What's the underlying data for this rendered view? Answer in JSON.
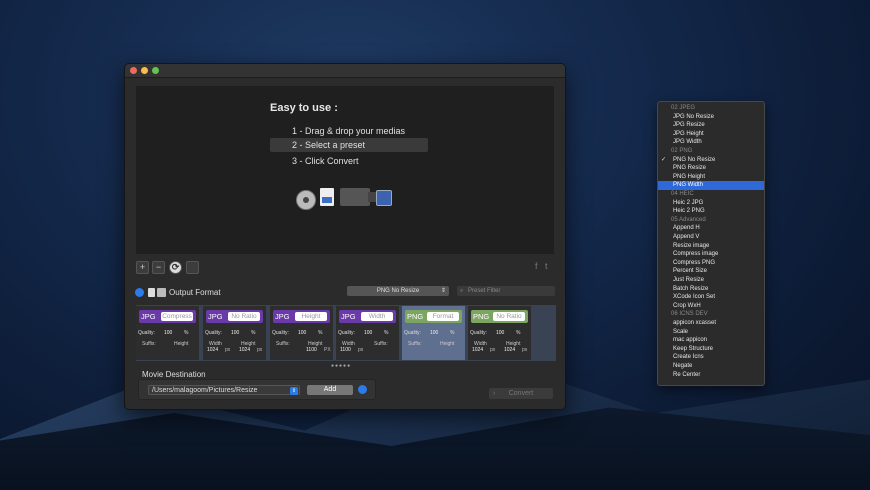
{
  "window": {
    "dropzone": {
      "title": "Easy to use :",
      "step1": "1 - Drag & drop your medias",
      "step2": "2 - Select a preset",
      "step3": "3 - Click Convert"
    },
    "toolbar": {
      "plus": "+",
      "minus": "−",
      "cycle": "⟳",
      "trash": "🗑"
    },
    "social": {
      "facebook": "f",
      "twitter": "t"
    },
    "output_format_label": "Output Format",
    "preset_select_value": "PNG No Resize",
    "preset_filter_placeholder": "Preset Filter",
    "cards": [
      {
        "format": "JPG",
        "preset": "Compress",
        "quality_label": "Quality:",
        "quality": "100",
        "pct": "%",
        "l1": "Suffix:",
        "l2": "Height",
        "v1": "",
        "v2": "",
        "u1": "",
        "u2": ""
      },
      {
        "format": "JPG",
        "preset": "No Ratio",
        "quality_label": "Quality:",
        "quality": "100",
        "pct": "%",
        "l1": "Width",
        "l2": "Height",
        "v1": "1024",
        "v2": "1024",
        "u1": "px",
        "u2": "px"
      },
      {
        "format": "JPG",
        "preset": "Height",
        "quality_label": "Quality:",
        "quality": "100",
        "pct": "%",
        "l1": "Suffix:",
        "l2": "Height",
        "v1": "",
        "v2": "1100",
        "u1": "",
        "u2": "PX"
      },
      {
        "format": "JPG",
        "preset": "Width",
        "quality_label": "Quality:",
        "quality": "100",
        "pct": "%",
        "l1": "Width",
        "l2": "Suffix:",
        "v1": "1100",
        "v2": "",
        "u1": "px",
        "u2": ""
      },
      {
        "format": "PNG",
        "preset": "Format",
        "quality_label": "Quality:",
        "quality": "100",
        "pct": "%",
        "l1": "Suffix:",
        "l2": "Height",
        "v1": "",
        "v2": "",
        "u1": "",
        "u2": ""
      },
      {
        "format": "PNG",
        "preset": "No Ratio",
        "quality_label": "Quality:",
        "quality": "100",
        "pct": "%",
        "l1": "Width",
        "l2": "Height",
        "v1": "1024",
        "v2": "1024",
        "u1": "px",
        "u2": "px"
      }
    ],
    "pager": "●●●●●",
    "movie_destination_label": "Movie Destination",
    "destination_path": "/Users/malagoom/Pictures/Resize",
    "add_label": "Add",
    "convert_label": "Convert"
  },
  "dropdown": {
    "items": [
      {
        "type": "header",
        "label": "02 JPEG"
      },
      {
        "type": "opt",
        "label": "JPG No Resize"
      },
      {
        "type": "opt",
        "label": "JPG Resize"
      },
      {
        "type": "opt",
        "label": "JPG Height"
      },
      {
        "type": "opt",
        "label": "JPG Width"
      },
      {
        "type": "header",
        "label": "02 PNG"
      },
      {
        "type": "opt",
        "label": "PNG No Resize",
        "checked": true
      },
      {
        "type": "opt",
        "label": "PNG Resize"
      },
      {
        "type": "opt",
        "label": "PNG Height"
      },
      {
        "type": "opt",
        "label": "PNG Width",
        "highlighted": true
      },
      {
        "type": "header",
        "label": "04 HEIC"
      },
      {
        "type": "opt",
        "label": "Heic 2 JPG"
      },
      {
        "type": "opt",
        "label": "Heic 2 PNG"
      },
      {
        "type": "header",
        "label": "05 Advanced"
      },
      {
        "type": "opt",
        "label": "Append H"
      },
      {
        "type": "opt",
        "label": "Append V"
      },
      {
        "type": "opt",
        "label": "Resize image"
      },
      {
        "type": "opt",
        "label": "Compress image"
      },
      {
        "type": "opt",
        "label": "Compress PNG"
      },
      {
        "type": "opt",
        "label": "Percent Size"
      },
      {
        "type": "opt",
        "label": "Just Resize"
      },
      {
        "type": "opt",
        "label": "Batch Resize"
      },
      {
        "type": "opt",
        "label": "XCode Icon Set"
      },
      {
        "type": "opt",
        "label": "Crop WxH"
      },
      {
        "type": "header",
        "label": "06 ICNS DEV"
      },
      {
        "type": "opt",
        "label": "appicon xcasset"
      },
      {
        "type": "opt",
        "label": "Scale"
      },
      {
        "type": "opt",
        "label": "mac appicon"
      },
      {
        "type": "opt",
        "label": "Keep Structure"
      },
      {
        "type": "opt",
        "label": "Create Icns"
      },
      {
        "type": "opt",
        "label": "Negate"
      },
      {
        "type": "opt",
        "label": "Re Center"
      }
    ],
    "checkmark": "✓"
  },
  "colors": {
    "accent": "#2f68d8",
    "jpg": "#6a3aa8",
    "png": "#7ba560"
  },
  "icons": [
    "film-icon",
    "document-icon",
    "camera-icon",
    "picture-icon",
    "facebook-icon",
    "twitter-icon",
    "plus-icon",
    "minus-icon",
    "cycle-icon",
    "trash-icon"
  ]
}
